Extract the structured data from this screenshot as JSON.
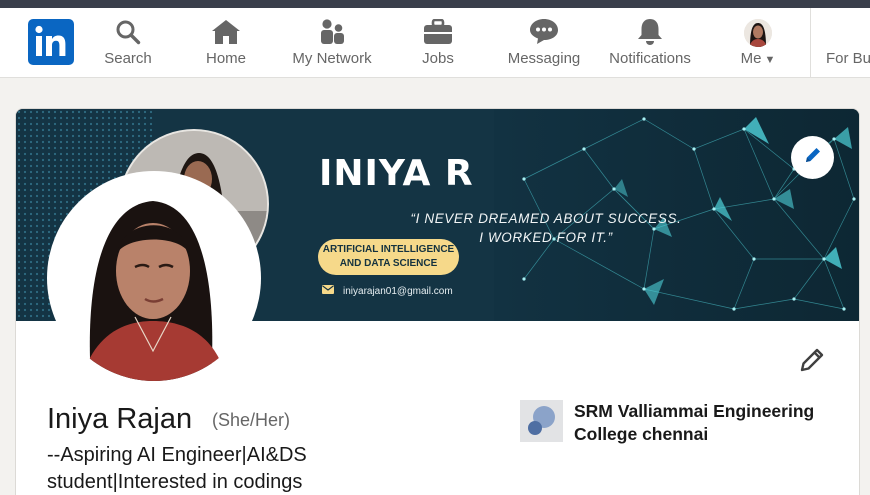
{
  "nav": {
    "items": [
      {
        "label": "Search",
        "icon": "search-icon"
      },
      {
        "label": "Home",
        "icon": "home-icon"
      },
      {
        "label": "My Network",
        "icon": "network-icon"
      },
      {
        "label": "Jobs",
        "icon": "briefcase-icon"
      },
      {
        "label": "Messaging",
        "icon": "message-icon"
      },
      {
        "label": "Notifications",
        "icon": "bell-icon"
      }
    ],
    "me_label": "Me",
    "business_label": "For Bu"
  },
  "banner": {
    "name": "INIYA R",
    "quote_line1": "“I NEVER DREAMED ABOUT SUCCESS.",
    "quote_line2": "I WORKED FOR IT.”",
    "pill_line1": "ARTIFICIAL INTELLIGENCE",
    "pill_line2": "AND DATA SCIENCE",
    "email": "iniyarajan01@gmail.com"
  },
  "profile": {
    "name": "Iniya Rajan",
    "pronouns": "(She/Her)",
    "headline": "--Aspiring AI Engineer|AI&DS student|Interested in codings",
    "education": "SRM Valliammai Engineering College chennai"
  },
  "colors": {
    "brand": "#0a66c2",
    "banner_bg": "#143444",
    "pill": "#f6d98a",
    "network_accent": "#4fd1d9"
  }
}
